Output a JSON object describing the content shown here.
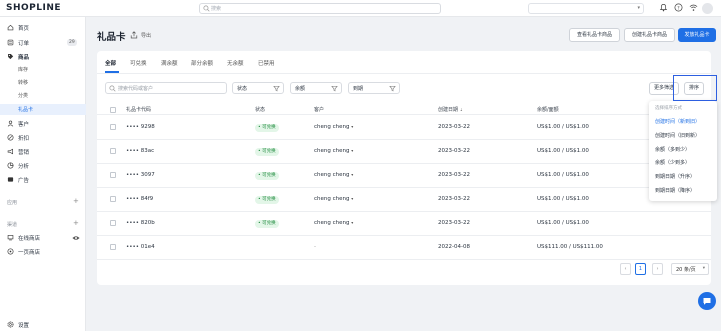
{
  "brand": {
    "logo_text": "SHOPLINE"
  },
  "topbar": {
    "search_placeholder": "搜索",
    "store_name": ""
  },
  "sidebar": {
    "items": [
      {
        "label": "首页",
        "icon": "home-icon"
      },
      {
        "label": "订单",
        "icon": "order-icon",
        "badge": "29"
      },
      {
        "label": "商品",
        "icon": "tag-icon"
      }
    ],
    "sub_items": [
      {
        "label": "库存"
      },
      {
        "label": "转移"
      },
      {
        "label": "分类"
      },
      {
        "label": "礼品卡",
        "active": true
      }
    ],
    "items2": [
      {
        "label": "客户",
        "icon": "user-icon"
      },
      {
        "label": "折扣",
        "icon": "discount-icon"
      },
      {
        "label": "营销",
        "icon": "megaphone-icon"
      },
      {
        "label": "分析",
        "icon": "chart-icon"
      },
      {
        "label": "广告",
        "icon": "ads-icon"
      }
    ],
    "section_apps": "应用",
    "section_channels": "渠道",
    "channels": [
      {
        "label": "在线商店",
        "icon": "store-icon"
      },
      {
        "label": "一页商店",
        "icon": "onepage-icon"
      }
    ],
    "settings": "设置"
  },
  "page": {
    "title": "礼品卡",
    "export_label": "导出",
    "buttons": {
      "view_products": "查看礼品卡商品",
      "create_product": "创建礼品卡商品",
      "issue": "发放礼品卡"
    }
  },
  "tabs": [
    "全部",
    "可兑换",
    "满余额",
    "部分余额",
    "无余额",
    "已禁用"
  ],
  "filters": {
    "search_placeholder": "搜索代码或客户",
    "status": "状态",
    "balance": "余额",
    "expiry": "到期",
    "more": "更多筛选",
    "sort": "排序"
  },
  "table": {
    "headers": [
      "礼品卡代码",
      "状态",
      "客户",
      "创建日期",
      "余额/面额"
    ],
    "rows": [
      {
        "code": "•••• 9298",
        "status": "• 可兑换",
        "customer": "cheng cheng",
        "date": "2023-03-22",
        "amount": "US$1.00 / US$1.00"
      },
      {
        "code": "•••• 83ac",
        "status": "• 可兑换",
        "customer": "cheng cheng",
        "date": "2023-03-22",
        "amount": "US$1.00 / US$1.00"
      },
      {
        "code": "•••• 3097",
        "status": "• 可兑换",
        "customer": "cheng cheng",
        "date": "2023-03-22",
        "amount": "US$1.00 / US$1.00"
      },
      {
        "code": "•••• 84f9",
        "status": "• 可兑换",
        "customer": "cheng cheng",
        "date": "2023-03-22",
        "amount": "US$1.00 / US$1.00"
      },
      {
        "code": "•••• 820b",
        "status": "• 可兑换",
        "customer": "cheng cheng",
        "date": "2023-03-22",
        "amount": "US$1.00 / US$1.00"
      },
      {
        "code": "•••• 01e4",
        "status": "",
        "customer": "-",
        "date": "2022-04-08",
        "amount": "US$111.00 / US$111.00"
      }
    ]
  },
  "sort_menu": {
    "header": "选择排序方式",
    "options": [
      {
        "label": "创建时间（新到旧）",
        "active": true
      },
      {
        "label": "创建时间（旧到新）"
      },
      {
        "label": "余额（多到少）"
      },
      {
        "label": "余额（少到多）"
      },
      {
        "label": "到期日期（升序）"
      },
      {
        "label": "到期日期（降序）"
      }
    ]
  },
  "pagination": {
    "prev": "‹",
    "page": "1",
    "next": "›",
    "per_page": "20 条/页"
  },
  "colors": {
    "accent": "#1f6fe5",
    "success_bg": "#e3f6e8",
    "success_text": "#1e8a3d"
  }
}
